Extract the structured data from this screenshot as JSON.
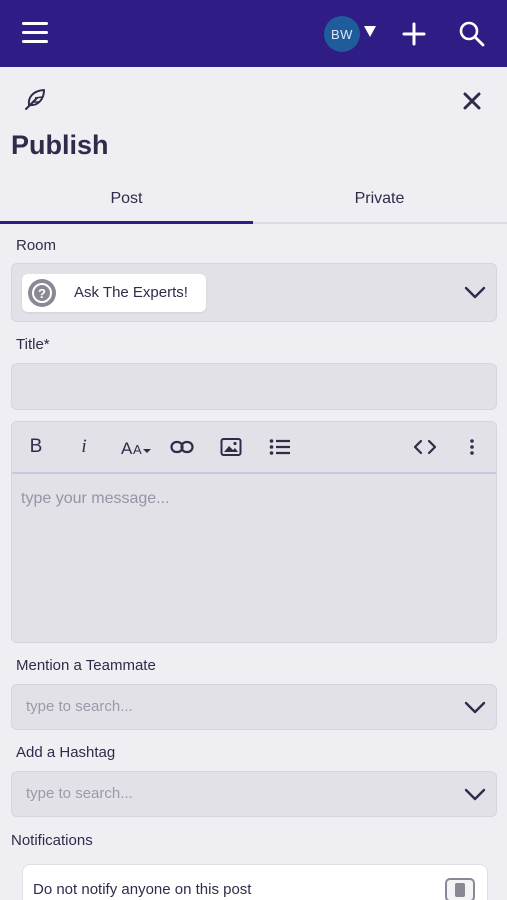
{
  "header": {
    "avatar_initials": "BW",
    "icons": [
      "hamburger-menu-icon",
      "caret-down-icon",
      "plus-icon",
      "search-icon"
    ],
    "background_color": "#2f1c84"
  },
  "publish": {
    "title": "Publish",
    "icons": [
      "feather-icon",
      "close-icon"
    ]
  },
  "tabs": [
    {
      "label": "Post",
      "active": true
    },
    {
      "label": "Private",
      "active": false
    }
  ],
  "room": {
    "label": "Room",
    "selected": "Ask The Experts!",
    "icon": "question-circle-icon"
  },
  "title_field": {
    "label": "Title*",
    "value": ""
  },
  "editor": {
    "toolbar": [
      "bold-icon",
      "italic-icon",
      "font-size-icon",
      "link-icon",
      "image-icon",
      "bulleted-list-icon",
      "code-view-icon",
      "more-vertical-icon"
    ],
    "placeholder": "type your message..."
  },
  "mention": {
    "label": "Mention a Teammate",
    "placeholder": "type to search..."
  },
  "hashtag": {
    "label": "Add a Hashtag",
    "placeholder": "type to search..."
  },
  "notifications": {
    "label": "Notifications",
    "option_text": "Do not notify anyone on this post",
    "checked": false
  }
}
